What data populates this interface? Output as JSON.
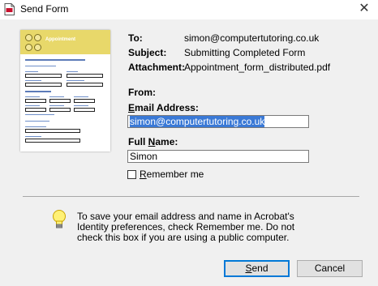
{
  "window": {
    "title": "Send Form",
    "close_glyph": "✕"
  },
  "thumbnail": {
    "title": "Appointment"
  },
  "details": {
    "to_label": "To:",
    "to_value": "simon@computertutoring.co.uk",
    "subject_label": "Subject:",
    "subject_value": "Submitting Completed Form",
    "attachment_label": "Attachment:",
    "attachment_value": "Appointment_form_distributed.pdf"
  },
  "from": {
    "from_label": "From:",
    "email_label": "Email Address:",
    "email_value": "simon@computertutoring.co.uk",
    "name_label": "Full Name:",
    "name_value": "Simon",
    "remember_label": "Remember me",
    "remember_checked": false
  },
  "info": {
    "text": "To save your email address and name in Acrobat's Identity preferences, check Remember me. Do not check this box if you are using a public computer."
  },
  "buttons": {
    "send": "Send",
    "cancel": "Cancel"
  },
  "colors": {
    "selection": "#3a79d6",
    "thumbnail_header": "#e8d86a",
    "default_button_border": "#0078d7"
  },
  "icons": {
    "app": "acrobat-document-icon",
    "info": "lightbulb-icon",
    "close": "close-icon"
  }
}
